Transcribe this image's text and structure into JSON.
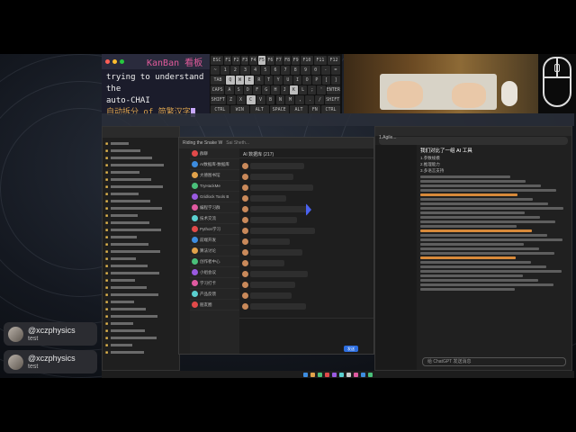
{
  "kanban": {
    "title": "KanBan 看板",
    "line1": "trying to understand the",
    "line2": "auto-CHAI",
    "line3": "自动拆分 of 简繁汉字"
  },
  "keyboard": {
    "row1": [
      "ESC",
      "F1",
      "F2",
      "F3",
      "F4",
      "F5",
      "F6",
      "F7",
      "F8",
      "F9",
      "F10",
      "F11",
      "F12"
    ],
    "row2": [
      "~",
      "1",
      "2",
      "3",
      "4",
      "5",
      "6",
      "7",
      "8",
      "9",
      "0",
      "-",
      "="
    ],
    "row3": [
      "TAB",
      "Q",
      "W",
      "E",
      "R",
      "T",
      "Y",
      "U",
      "I",
      "O",
      "P",
      "[",
      "]"
    ],
    "row4": [
      "CAPS",
      "A",
      "S",
      "D",
      "F",
      "G",
      "H",
      "J",
      "K",
      "L",
      ";",
      "'",
      "ENTER"
    ],
    "row5": [
      "SHIFT",
      "Z",
      "X",
      "C",
      "V",
      "B",
      "N",
      "M",
      ",",
      ".",
      "/",
      "SHIFT"
    ],
    "row6": [
      "CTRL",
      "WIN",
      "ALT",
      "SPACE",
      "ALT",
      "FN",
      "CTRL"
    ]
  },
  "chat_window": {
    "title": "Riding the Snake W",
    "tab2": "Sai Sheth...",
    "header": "AI 数据库 (217)",
    "contacts": [
      "群聊",
      "AI数据库-数据库",
      "大德图书馆",
      "TryHackMe",
      "Gridlock Tools B",
      "编程学习群",
      "技术交流",
      "Python学习",
      "前端开发",
      "算法讨论",
      "创作者中心",
      "小组会议",
      "学习打卡",
      "产品反馈",
      "朋友圈"
    ],
    "send_label": "发送"
  },
  "browser": {
    "tab": "1.Agile...",
    "heading": "我们对比了一组 AI 工具",
    "chat_placeholder": "给 ChatGPT 发送消息",
    "table_rows": [
      "1.参数规模",
      "2.推理能力",
      "3.多语言支持"
    ]
  },
  "followers": [
    {
      "name": "@xczphysics",
      "sub": "test"
    },
    {
      "name": "@xczphysics",
      "sub": "test"
    }
  ],
  "colors": {
    "kanban_title": "#e05a9a",
    "kanban_cn": "#d9a24e",
    "accent_blue": "#2d6ee0"
  }
}
